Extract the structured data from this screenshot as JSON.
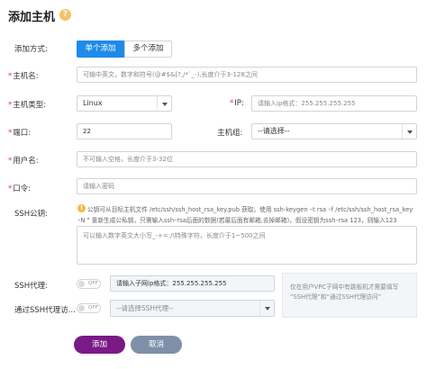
{
  "dialog": {
    "title": "添加主机",
    "help_icon": "?"
  },
  "add_mode": {
    "label": "添加方式:",
    "options": [
      "单个添加",
      "多个添加"
    ],
    "selected": "单个添加"
  },
  "hostname": {
    "label": "主机名:",
    "placeholder": "可输中英文，数字和符号(@#$&[?,/*`_-),长度介于3-128之间"
  },
  "host_type": {
    "label": "主机类型:",
    "value": "Linux"
  },
  "ip": {
    "label": "IP:",
    "placeholder": "请输入ip格式：255.255.255.255"
  },
  "port": {
    "label": "端口:",
    "value": "22"
  },
  "host_group": {
    "label": "主机组:",
    "value": "--请选择--"
  },
  "username": {
    "label": "用户名:",
    "placeholder": "不可输入空格，长度介于3-32位"
  },
  "password": {
    "label": "口令:",
    "placeholder": "请输入密码"
  },
  "ssh_key": {
    "label": "SSH公钥:",
    "hint_line1": "公钥可从目标主机文件 /etc/ssh/ssh_host_rsa_key.pub 获取。使用 ssh-keygen –t rsa –f /etc/ssh/ssh_host_rsa_key",
    "hint_line2": "–N \" 重新生成公私钥，只需输入ssh–rsa后面的数据(若最后面有邮箱,去掉邮箱)，假设密钥为ssh–rsa 123，则输入123",
    "placeholder": "可以输入数字英文大小写_-+=:/\\特殊字符，长度介于1~500之间"
  },
  "ssh_proxy": {
    "label": "SSH代理:",
    "toggle": "OFF",
    "placeholder": "请输入子网ip格式：255.255.255.255"
  },
  "via_ssh_proxy": {
    "label": "通过SSH代理访...",
    "toggle": "OFF",
    "value": "--请选择SSH代理--"
  },
  "side_note": {
    "line1": "仅在用户VPC子网中有跳板机才需要填写",
    "line2": "“SSH代理”和“通过SSH代理访问”"
  },
  "buttons": {
    "add": "添加",
    "cancel": "取消"
  },
  "colors": {
    "primary": "#1e8bea",
    "add_button": "#7a1a87",
    "cancel_button": "#7f8fa8",
    "required": "#e23c3c",
    "help": "#f5c266"
  }
}
